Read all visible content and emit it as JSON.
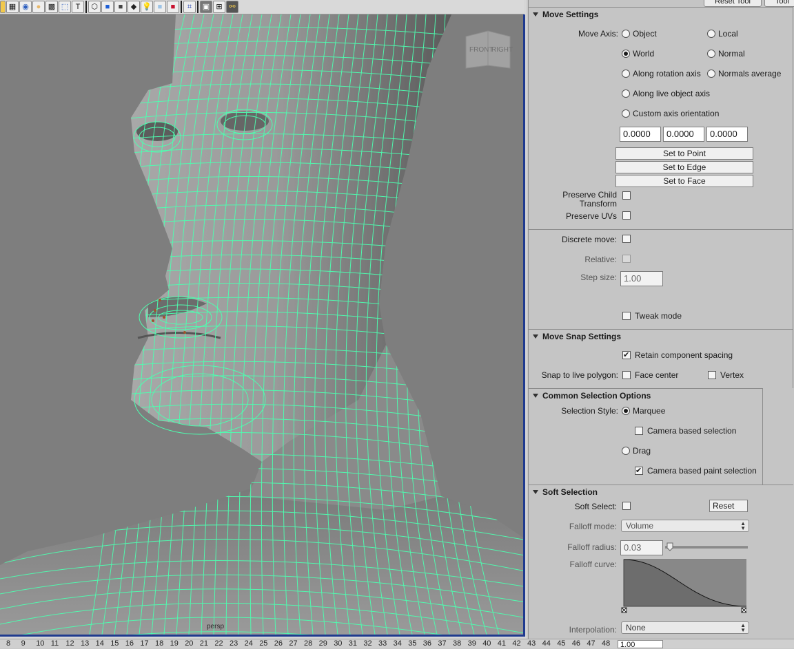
{
  "toolbar": {
    "icons": [
      "snap-grid-icon",
      "select-icon",
      "camera-icon",
      "light-icon",
      "grid-icon",
      "uv-icon",
      "text-icon",
      "wireframe-cube-icon",
      "shaded-cube-icon",
      "smooth-cube-icon",
      "texture-cube-icon",
      "light-bulb-icon",
      "xray-icon",
      "red-cube-icon",
      "isolate-icon",
      "frame-icon",
      "film-gate-icon",
      "joint-icon"
    ]
  },
  "viewport": {
    "camera_label": "persp",
    "viewcube_front": "FRONT",
    "viewcube_right": "RIGHT",
    "wire_color": "#4dffb0",
    "border_color": "#1f3a8f"
  },
  "timeline": {
    "ticks": [
      "8",
      "9",
      "10",
      "11",
      "12",
      "13",
      "14",
      "15",
      "16",
      "17",
      "18",
      "19",
      "20",
      "21",
      "22",
      "23",
      "24",
      "25",
      "26",
      "27",
      "28",
      "29",
      "30",
      "31",
      "32",
      "33",
      "34",
      "35",
      "36",
      "37",
      "38",
      "39",
      "40",
      "41",
      "42",
      "43",
      "44",
      "45",
      "46",
      "47",
      "48"
    ],
    "current_time": "1.00"
  },
  "panel": {
    "reset_tool": "Reset Tool",
    "tool_help": "Tool"
  },
  "move_settings": {
    "title": "Move Settings",
    "move_axis_label": "Move Axis:",
    "object": "Object",
    "local": "Local",
    "world": "World",
    "normal": "Normal",
    "along_rotation_axis": "Along rotation axis",
    "normals_average": "Normals average",
    "along_live_object_axis": "Along live object axis",
    "custom_axis_orientation": "Custom axis orientation",
    "axis_x": "0.0000",
    "axis_y": "0.0000",
    "axis_z": "0.0000",
    "set_to_point": "Set to Point",
    "set_to_edge": "Set to Edge",
    "set_to_face": "Set to Face",
    "preserve_child_1": "Preserve Child",
    "preserve_child_2": "Transform",
    "preserve_uvs": "Preserve UVs",
    "discrete_move": "Discrete move:",
    "relative": "Relative:",
    "step_size": "Step size:",
    "step_size_value": "1.00",
    "tweak_mode": "Tweak mode"
  },
  "move_snap": {
    "title": "Move Snap Settings",
    "retain_spacing": "Retain component spacing",
    "snap_live_polygon": "Snap to live polygon:",
    "face_center": "Face center",
    "vertex": "Vertex"
  },
  "common_selection": {
    "title": "Common Selection Options",
    "selection_style": "Selection Style:",
    "marquee": "Marquee",
    "camera_based_selection": "Camera based selection",
    "drag": "Drag",
    "camera_based_paint": "Camera based paint selection"
  },
  "soft_selection": {
    "title": "Soft Selection",
    "soft_select": "Soft Select:",
    "reset": "Reset",
    "falloff_mode": "Falloff mode:",
    "falloff_mode_value": "Volume",
    "falloff_radius": "Falloff radius:",
    "falloff_radius_value": "0.03",
    "falloff_radius_level": 0.03,
    "falloff_curve": "Falloff curve:",
    "interpolation": "Interpolation:",
    "interpolation_value": "None"
  }
}
